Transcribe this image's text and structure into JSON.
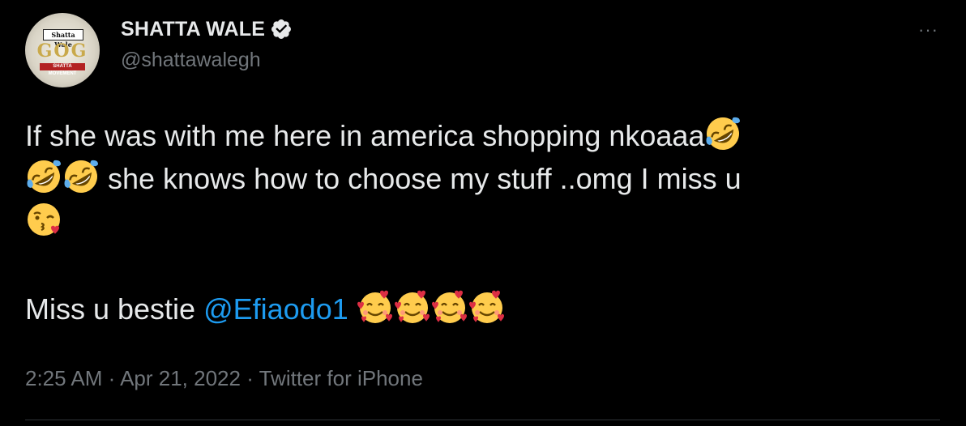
{
  "author": {
    "display_name": "SHATTA WALE",
    "handle": "@shattawalegh",
    "verified": true,
    "avatar_text_top": "Shatta Wale",
    "avatar_text_mid": "GOG",
    "avatar_text_bottom": "SHATTA MOVEMENT"
  },
  "menu_label": "···",
  "tweet": {
    "line1": "If she was with me here in america shopping nkoaaa",
    "line2": "she knows how to choose my stuff ..omg I miss u",
    "line4_text": "Miss u bestie ",
    "mention": "@Efiaodo1"
  },
  "meta": {
    "time": "2:25 AM",
    "date": "Apr 21, 2022",
    "source": "Twitter for iPhone",
    "separator": " · "
  },
  "colors": {
    "background": "#000000",
    "text": "#e7e9ea",
    "secondary": "#71767b",
    "link": "#1d9bf0"
  },
  "icons": {
    "verified": "verified-badge-icon",
    "laughing": "rolling-on-floor-laughing-emoji",
    "kiss": "face-blowing-kiss-emoji",
    "hearts": "smiling-face-with-hearts-emoji"
  }
}
